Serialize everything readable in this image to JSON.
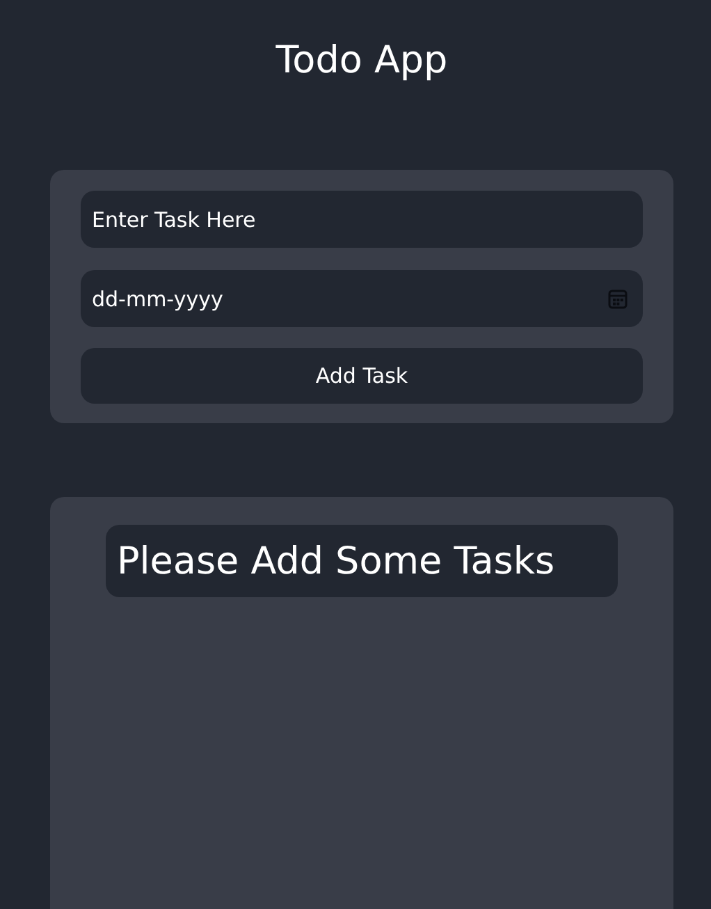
{
  "title": "Todo App",
  "form": {
    "task_field": {
      "placeholder": "Enter Task Here"
    },
    "date_field": {
      "placeholder": "dd-mm-yyyy"
    },
    "submit_button": "Add Task"
  },
  "task_list": {
    "empty_message": "Please Add Some Tasks"
  }
}
